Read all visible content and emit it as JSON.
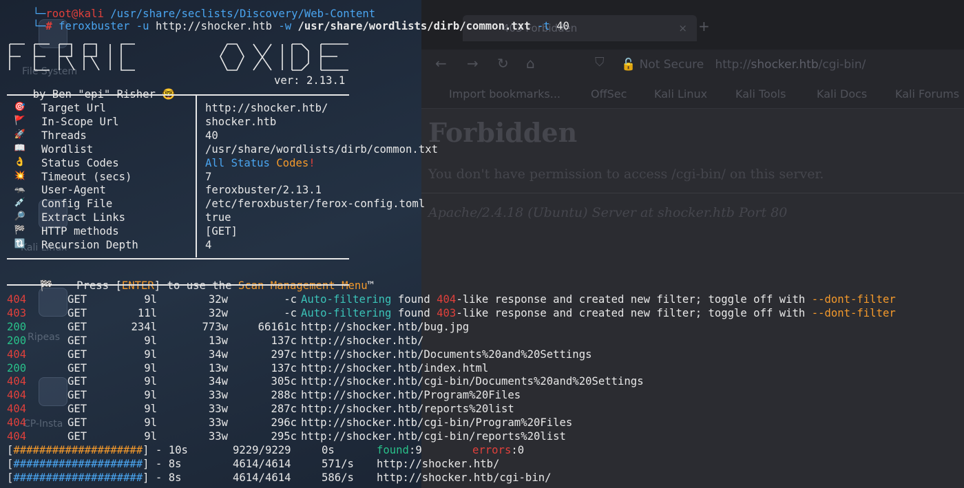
{
  "terminal": {
    "prompt_top": "root@kali",
    "prompt_path": "/usr/share/seclists/Discovery/Web-Content",
    "command": {
      "symbol": "#",
      "binary": "feroxbuster",
      "flag_u": "-u",
      "url": "http://shocker.htb",
      "flag_w": "-w",
      "wordlist": "/usr/share/wordlists/dirb/common.txt",
      "flag_t": "-t",
      "threads": "40"
    },
    "banner": {
      "logo_text": "FERRIC OXIDE",
      "author": "by Ben \"epi\" Risher 🤓",
      "version": "ver: 2.13.1"
    },
    "config": [
      {
        "icon": "target-icon",
        "glyph": "🎯",
        "label": "Target Url",
        "value": "http://shocker.htb/"
      },
      {
        "icon": "flag-icon",
        "glyph": "🚩",
        "label": "In-Scope Url",
        "value": "shocker.htb"
      },
      {
        "icon": "rocket-icon",
        "glyph": "🚀",
        "label": "Threads",
        "value": "40"
      },
      {
        "icon": "book-icon",
        "glyph": "📖",
        "label": "Wordlist",
        "value": "/usr/share/wordlists/dirb/common.txt"
      },
      {
        "icon": "ok-hand-icon",
        "glyph": "👌",
        "label": "Status Codes",
        "value_parts": [
          "All",
          "Status",
          "Codes",
          "!"
        ]
      },
      {
        "icon": "explosion-icon",
        "glyph": "💥",
        "label": "Timeout (secs)",
        "value": "7"
      },
      {
        "icon": "umbrella-icon",
        "glyph": "🦡",
        "label": "User-Agent",
        "value": "feroxbuster/2.13.1"
      },
      {
        "icon": "syringe-icon",
        "glyph": "💉",
        "label": "Config File",
        "value": "/etc/feroxbuster/ferox-config.toml"
      },
      {
        "icon": "magnifier-icon",
        "glyph": "🔎",
        "label": "Extract Links",
        "value": "true"
      },
      {
        "icon": "checkered-flag-icon",
        "glyph": "🏁",
        "label": "HTTP methods",
        "value": "[GET]"
      },
      {
        "icon": "repeat-icon",
        "glyph": "🔃",
        "label": "Recursion Depth",
        "value": "4"
      }
    ],
    "press_line": {
      "glyph": "🏁",
      "prefix": "Press [",
      "key": "ENTER",
      "middle": "] to use the ",
      "menu": "Scan Management Menu",
      "suffix": "™"
    },
    "results": [
      {
        "status": "404",
        "method": "GET",
        "lines": "9l",
        "words": "32w",
        "chars": "-c",
        "kind": "filter",
        "filter_code": "404"
      },
      {
        "status": "403",
        "method": "GET",
        "lines": "11l",
        "words": "32w",
        "chars": "-c",
        "kind": "filter",
        "filter_code": "403"
      },
      {
        "status": "200",
        "method": "GET",
        "lines": "234l",
        "words": "773w",
        "chars": "66161c",
        "url": "http://shocker.htb/bug.jpg"
      },
      {
        "status": "200",
        "method": "GET",
        "lines": "9l",
        "words": "13w",
        "chars": "137c",
        "url": "http://shocker.htb/"
      },
      {
        "status": "404",
        "method": "GET",
        "lines": "9l",
        "words": "34w",
        "chars": "297c",
        "url": "http://shocker.htb/Documents%20and%20Settings"
      },
      {
        "status": "200",
        "method": "GET",
        "lines": "9l",
        "words": "13w",
        "chars": "137c",
        "url": "http://shocker.htb/index.html"
      },
      {
        "status": "404",
        "method": "GET",
        "lines": "9l",
        "words": "34w",
        "chars": "305c",
        "url": "http://shocker.htb/cgi-bin/Documents%20and%20Settings"
      },
      {
        "status": "404",
        "method": "GET",
        "lines": "9l",
        "words": "33w",
        "chars": "288c",
        "url": "http://shocker.htb/Program%20Files"
      },
      {
        "status": "404",
        "method": "GET",
        "lines": "9l",
        "words": "33w",
        "chars": "287c",
        "url": "http://shocker.htb/reports%20list"
      },
      {
        "status": "404",
        "method": "GET",
        "lines": "9l",
        "words": "33w",
        "chars": "296c",
        "url": "http://shocker.htb/cgi-bin/Program%20Files"
      },
      {
        "status": "404",
        "method": "GET",
        "lines": "9l",
        "words": "33w",
        "chars": "295c",
        "url": "http://shocker.htb/cgi-bin/reports%20list"
      }
    ],
    "filter_text": {
      "auto": "Auto-filtering",
      "found": " found ",
      "rest": "-like response and created new filter; toggle off with ",
      "flag": "--dont-filter"
    },
    "progress": [
      {
        "bar": "####################",
        "time": "10s",
        "count": "9229/9229",
        "rate": "0s",
        "found_label": "found",
        "found_value": ":9",
        "errors_label": "errors",
        "errors_value": ":0",
        "color": "#f59a2b"
      },
      {
        "bar": "####################",
        "time": "8s",
        "count": "4614/4614",
        "rate": "571/s",
        "url": "http://shocker.htb/",
        "color": "#4aa5f0"
      },
      {
        "bar": "####################",
        "time": "8s",
        "count": "4614/4614",
        "rate": "586/s",
        "url": "http://shocker.htb/cgi-bin/",
        "color": "#4aa5f0"
      }
    ]
  },
  "browser": {
    "tab_title": "403 Forbidden",
    "tab_close": "×",
    "new_tab": "+",
    "security_label": "Not Secure",
    "url_host": "shocker.htb",
    "url_full_prefix": "http://",
    "url_path": "/cgi-bin/",
    "bookmarks": [
      "Import bookmarks...",
      "OffSec",
      "Kali Linux",
      "Kali Tools",
      "Kali Docs",
      "Kali Forums"
    ],
    "page_heading": "Forbidden",
    "page_message": "You don't have permission to access /cgi-bin/ on this server.",
    "page_address": "Apache/2.4.18 (Ubuntu) Server at shocker.htb Port 80"
  },
  "desktop": {
    "labels": [
      "File System",
      "Kali Linux",
      "Ripeas",
      "CP-Insta"
    ]
  },
  "colors": {
    "status_404": "#e0403b",
    "status_403": "#e0403b",
    "status_200": "#29c08a",
    "auto_filter": "#3bc3b8",
    "accent_orange": "#f59a2b",
    "accent_blue": "#4aa5f0"
  }
}
